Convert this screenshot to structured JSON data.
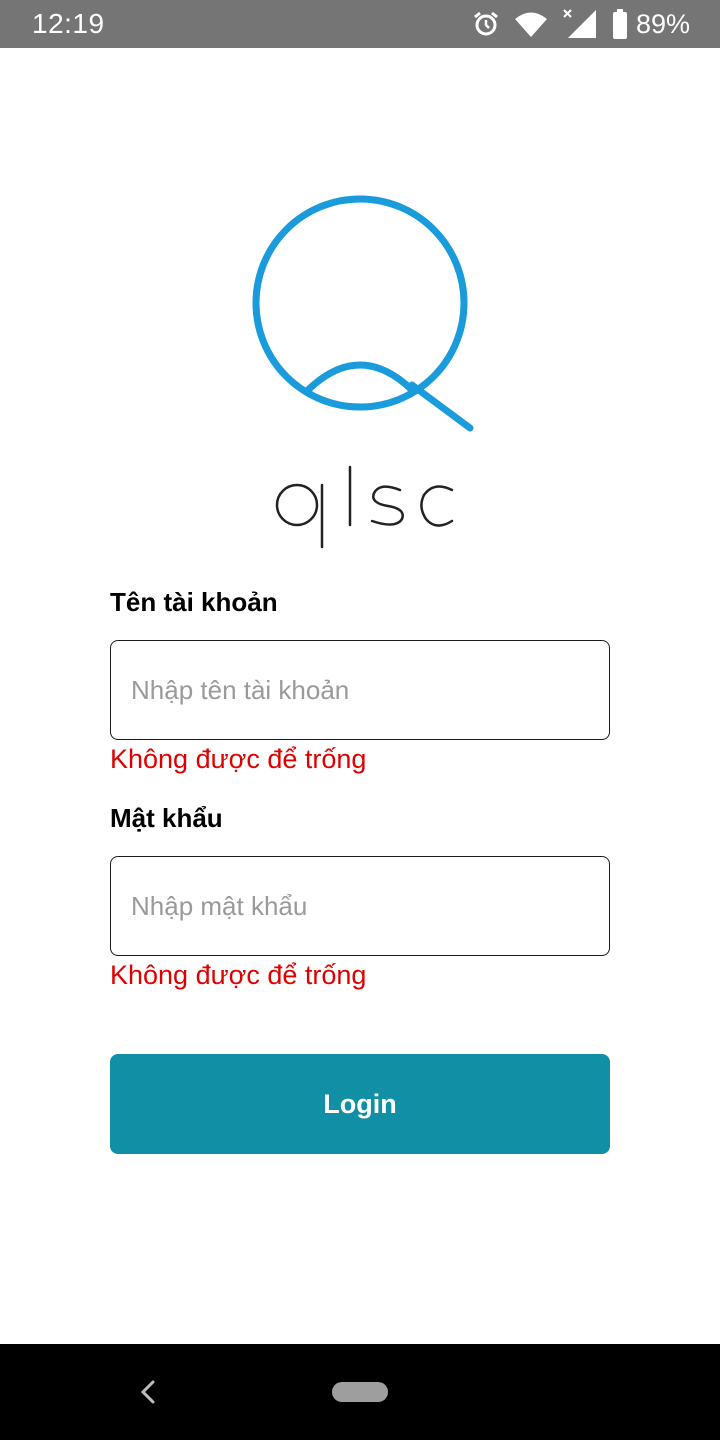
{
  "status_bar": {
    "time": "12:19",
    "battery_percent": "89%",
    "icons": [
      "alarm-icon",
      "wifi-icon",
      "signal-no-data-icon",
      "battery-icon"
    ]
  },
  "logo": {
    "text": "qlsc",
    "color": "#1a9bdb"
  },
  "form": {
    "username": {
      "label": "Tên tài khoản",
      "placeholder": "Nhập tên tài khoản",
      "value": "",
      "error": "Không được để trống"
    },
    "password": {
      "label": "Mật khẩu",
      "placeholder": "Nhập mật khẩu",
      "value": "",
      "error": "Không được để trống"
    },
    "login_label": "Login"
  },
  "colors": {
    "primary": "#118fa5",
    "error": "#e00000",
    "status_bar": "#757575"
  },
  "nav_bar": {
    "icons": [
      "back-icon",
      "home-pill-icon"
    ]
  }
}
